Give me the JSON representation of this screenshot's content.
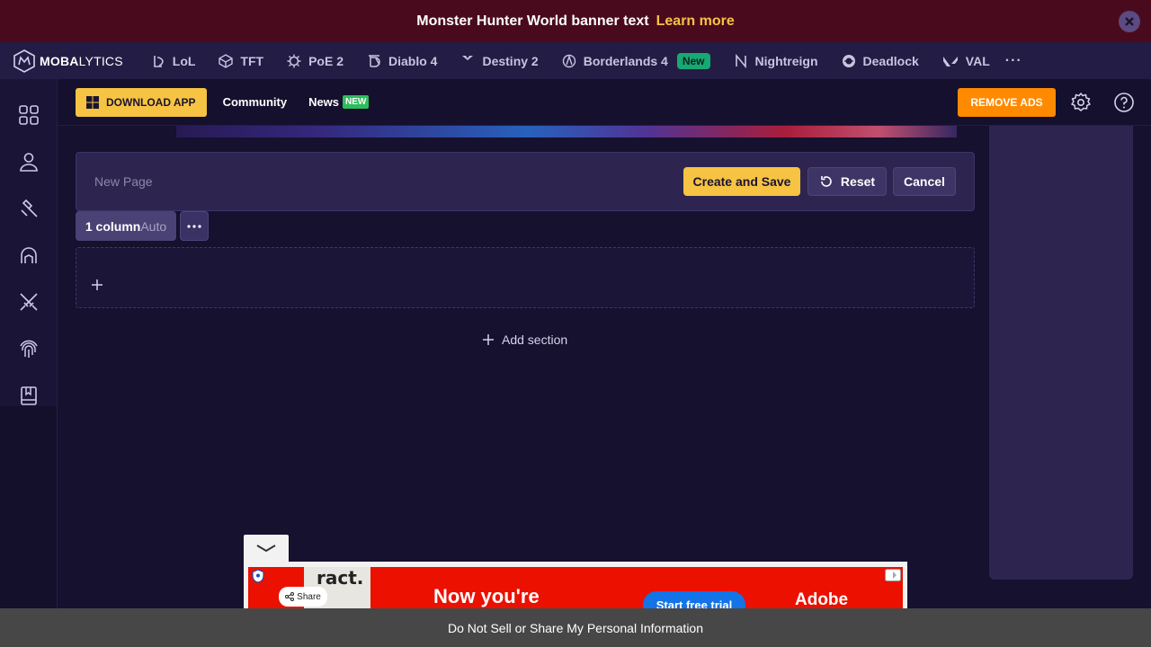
{
  "banner": {
    "text": "Monster Hunter World banner text",
    "link": "Learn more"
  },
  "logo": {
    "bold": "MOBA",
    "rest": "LYTICS"
  },
  "games": [
    {
      "label": "LoL",
      "icon": "lol-icon"
    },
    {
      "label": "TFT",
      "icon": "tft-icon"
    },
    {
      "label": "PoE 2",
      "icon": "poe2-icon"
    },
    {
      "label": "Diablo 4",
      "icon": "diablo4-icon"
    },
    {
      "label": "Destiny 2",
      "icon": "destiny2-icon"
    },
    {
      "label": "Borderlands 4",
      "icon": "borderlands4-icon",
      "badge": "New"
    },
    {
      "label": "Nightreign",
      "icon": "nightreign-icon"
    },
    {
      "label": "Deadlock",
      "icon": "deadlock-icon"
    },
    {
      "label": "VAL",
      "icon": "valorant-icon"
    }
  ],
  "more_label": "···",
  "subheader": {
    "download": "DOWNLOAD APP",
    "community": "Community",
    "news": "News",
    "news_badge": "NEW",
    "remove_ads": "REMOVE ADS"
  },
  "editor": {
    "page_name": "New Page",
    "create_save": "Create and Save",
    "reset": "Reset",
    "cancel": "Cancel"
  },
  "columns": {
    "count": "1 column",
    "mode": "Auto"
  },
  "add_section": "Add section",
  "ad": {
    "thumb_text": "ract.",
    "share": "Share",
    "headline": "Now you're",
    "cta": "Start free trial",
    "brand": "Adobe"
  },
  "footer": "Do Not Sell or Share My Personal Information",
  "colors": {
    "accent": "#f6c343",
    "orange": "#ff8a00",
    "banner": "#4a0a1e",
    "panel": "#2d2550"
  }
}
